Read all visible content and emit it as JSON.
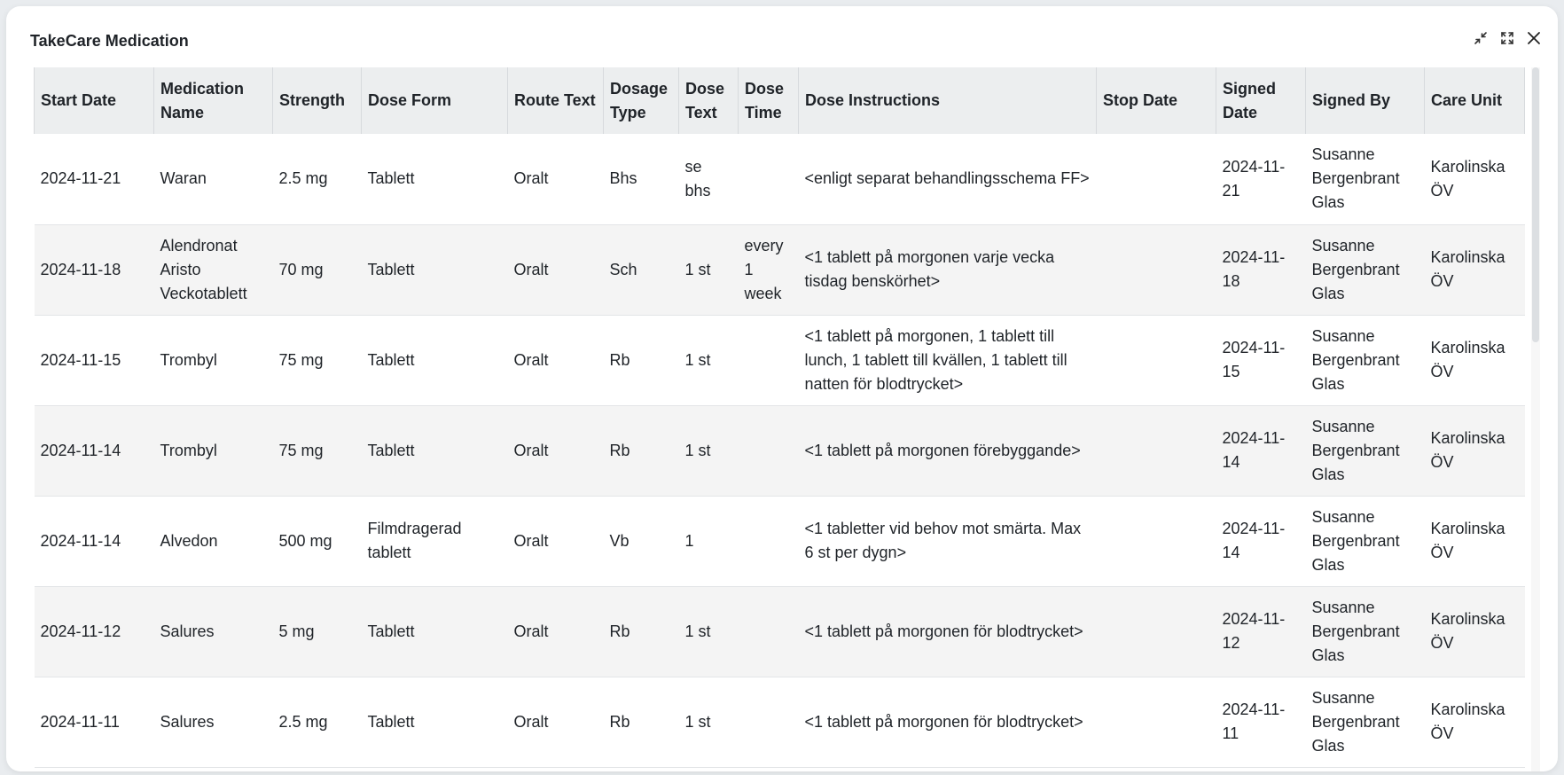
{
  "dialog": {
    "title": "TakeCare Medication"
  },
  "controls": {
    "minimize_icon": "collapse-arrows-icon",
    "maximize_icon": "expand-arrows-icon",
    "close_icon": "close-icon"
  },
  "table": {
    "columns": [
      "Start Date",
      "Medication Name",
      "Strength",
      "Dose Form",
      "Route Text",
      "Dosage Type",
      "Dose Text",
      "Dose Time",
      "Dose Instructions",
      "Stop Date",
      "Signed Date",
      "Signed By",
      "Care Unit"
    ],
    "rows": [
      [
        "2024-11-21",
        "Waran",
        "2.5 mg",
        "Tablett",
        "Oralt",
        "Bhs",
        "se bhs",
        "",
        "<enligt separat behandlingsschema FF>",
        "",
        "2024-11-21",
        "Susanne Bergenbrant Glas",
        "Karolinska ÖV"
      ],
      [
        "2024-11-18",
        "Alendronat Aristo Veckotablett",
        "70 mg",
        "Tablett",
        "Oralt",
        "Sch",
        "1 st",
        "every 1 week",
        "<1 tablett på morgonen varje vecka tisdag benskörhet>",
        "",
        "2024-11-18",
        "Susanne Bergenbrant Glas",
        "Karolinska ÖV"
      ],
      [
        "2024-11-15",
        "Trombyl",
        "75 mg",
        "Tablett",
        "Oralt",
        "Rb",
        "1 st",
        "",
        "<1 tablett på morgonen, 1 tablett till lunch, 1 tablett till kvällen, 1 tablett till natten för blodtrycket>",
        "",
        "2024-11-15",
        "Susanne Bergenbrant Glas",
        "Karolinska ÖV"
      ],
      [
        "2024-11-14",
        "Trombyl",
        "75 mg",
        "Tablett",
        "Oralt",
        "Rb",
        "1 st",
        "",
        "<1 tablett på morgonen förebyggande>",
        "",
        "2024-11-14",
        "Susanne Bergenbrant Glas",
        "Karolinska ÖV"
      ],
      [
        "2024-11-14",
        "Alvedon",
        "500 mg",
        "Filmdragerad tablett",
        "Oralt",
        "Vb",
        "1",
        "",
        "<1 tabletter vid behov mot smärta. Max 6 st per dygn>",
        "",
        "2024-11-14",
        "Susanne Bergenbrant Glas",
        "Karolinska ÖV"
      ],
      [
        "2024-11-12",
        "Salures",
        "5 mg",
        "Tablett",
        "Oralt",
        "Rb",
        "1 st",
        "",
        "<1 tablett på morgonen för blodtrycket>",
        "",
        "2024-11-12",
        "Susanne Bergenbrant Glas",
        "Karolinska ÖV"
      ],
      [
        "2024-11-11",
        "Salures",
        "2.5 mg",
        "Tablett",
        "Oralt",
        "Rb",
        "1 st",
        "",
        "<1 tablett på morgonen för blodtrycket>",
        "",
        "2024-11-11",
        "Susanne Bergenbrant Glas",
        "Karolinska ÖV"
      ]
    ]
  }
}
